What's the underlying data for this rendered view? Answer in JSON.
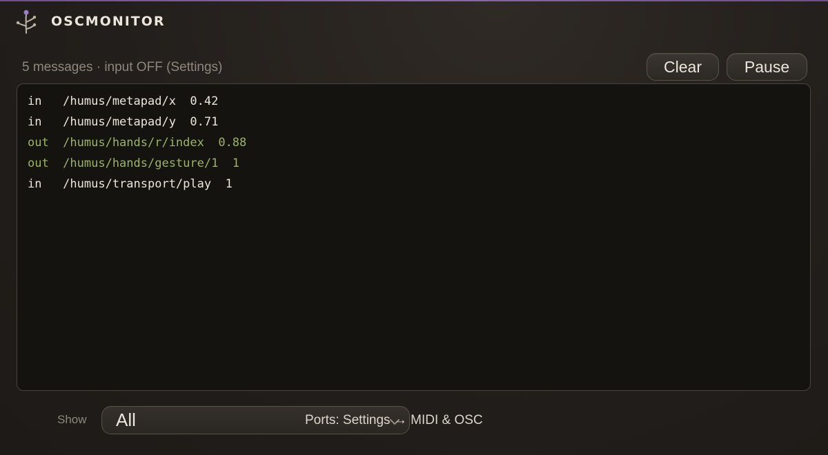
{
  "app": {
    "title": "OSCMONITOR",
    "logo_icon": "sprout-icon",
    "accent_color": "#8a6aa8"
  },
  "status": {
    "text": "5 messages · input OFF (Settings)"
  },
  "toolbar": {
    "clear_label": "Clear",
    "pause_label": "Pause"
  },
  "log": {
    "colors": {
      "in": "#ece6dc",
      "out": "#9bb36a"
    },
    "messages": [
      {
        "text": "in   /humus/metapad/x  0.42",
        "direction": "in"
      },
      {
        "text": "in   /humus/metapad/y  0.71",
        "direction": "in"
      },
      {
        "text": "out  /humus/hands/r/index  0.88",
        "direction": "out"
      },
      {
        "text": "out  /humus/hands/gesture/1  1",
        "direction": "out"
      },
      {
        "text": "in   /humus/transport/play  1",
        "direction": "in"
      }
    ]
  },
  "footer": {
    "show_label": "Show",
    "show_value": "All",
    "show_chevron_icon": "chevron-down-icon",
    "ports_text": "Ports: Settings → MIDI & OSC"
  }
}
